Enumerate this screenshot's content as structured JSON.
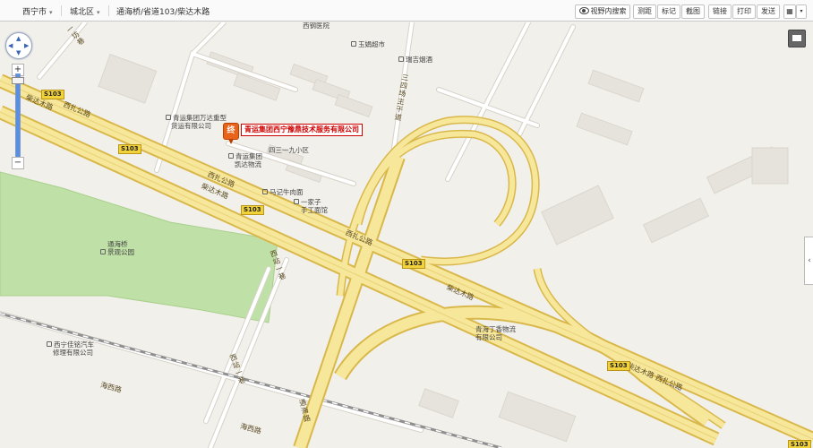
{
  "toolbar": {
    "city": "西宁市",
    "district": "城北区",
    "address": "通海桥/省道103/柴达木路",
    "view_search": "视野内搜索",
    "ranging": "测距",
    "mark": "标记",
    "screenshot": "截图",
    "link": "链接",
    "print": "打印",
    "send": "发送"
  },
  "map": {
    "result_marker": "终",
    "result_label": "青运集团西宁豫鼎技术服务有限公司",
    "pois": [
      "西钢医院",
      "玉娟超市",
      "瑞吉烟酒",
      "青运集团万达重型",
      "货运有限公司",
      "青运集团",
      "凯达物流",
      "四三一九小区",
      "马记牛肉面",
      "一家子",
      "手工面馆",
      "通海桥",
      "景观公园",
      "青海丁香物流",
      "有限公司",
      "西宁佳铭汽车",
      "修理有限公司"
    ],
    "roads": {
      "xizha_1": "西扎公路",
      "chaidamu_1": "柴达木路",
      "xizha_2": "西扎公路",
      "chaidamu_2": "柴达木路",
      "xizha_3": "西扎公路",
      "chaidamu_3": "柴达木路",
      "xizha_4": "柴达木路 西扎公路",
      "sansijiao": "三四场主干道",
      "xizhan_1": "西站一巷",
      "xizhan_2": "西站一巷",
      "tonghai": "通海路",
      "haixi_1": "海西路",
      "haixi_2": "海西路",
      "fang": "一坊巷"
    },
    "shields": [
      "S103",
      "S103",
      "S103",
      "S103",
      "S103",
      "S103"
    ],
    "zoom_in": "+",
    "zoom_out": "−",
    "side_arrow": "‹"
  },
  "colors": {
    "road_fill": "#f7e79b",
    "road_edge": "#d9b84b",
    "park": "#bfe0a6",
    "background": "#f2f0ea",
    "building": "#e6e3dc",
    "accent": "#cc0000"
  }
}
